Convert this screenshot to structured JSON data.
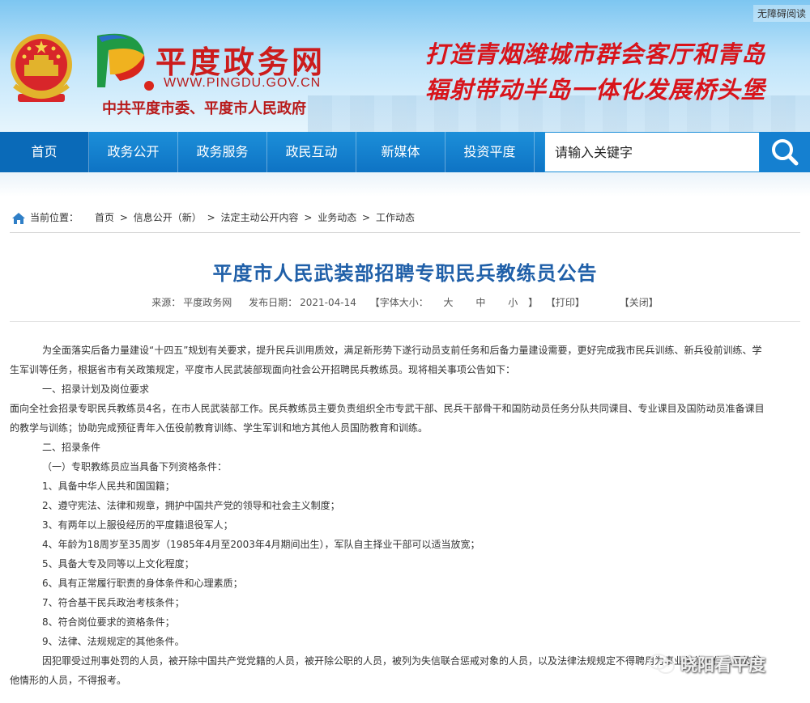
{
  "header": {
    "accessibility": "无障碍阅读",
    "site_name": "平度政务网",
    "site_url": "WWW.PINGDU.GOV.CN",
    "site_owner": "中共平度市委、平度市人民政府",
    "slogan_line1": "打造青烟潍城市群会客厅和青岛",
    "slogan_line2": "辐射带动半岛一体化发展桥头堡"
  },
  "nav": {
    "items": [
      {
        "label": "首页"
      },
      {
        "label": "政务公开"
      },
      {
        "label": "政务服务"
      },
      {
        "label": "政民互动"
      },
      {
        "label": "新媒体"
      },
      {
        "label": "投资平度"
      }
    ],
    "search_placeholder": "请输入关键字"
  },
  "breadcrumb": {
    "label": "当前位置：",
    "items": [
      "首页",
      "信息公开（新）",
      "法定主动公开内容",
      "业务动态",
      "工作动态"
    ],
    "separator": ">"
  },
  "article": {
    "title": "平度市人民武装部招聘专职民兵教练员公告",
    "source_label": "来源：",
    "source": "平度政务网",
    "date_label": "发布日期：",
    "date": "2021-04-14",
    "font_label": "【字体大小：",
    "font_large": "大",
    "font_medium": "中",
    "font_small": "小",
    "font_close": "】",
    "print": "【打印】",
    "close": "【关闭】",
    "paragraphs": [
      "为全面落实后备力量建设“十四五”规划有关要求，提升民兵训用质效，满足新形势下遂行动员支前任务和后备力量建设需要，更好完成我市民兵训练、新兵役前训练、学生军训等任务，根据省市有关政策规定，平度市人民武装部现面向社会公开招聘民兵教练员。现将相关事项公告如下：",
      "一、招录计划及岗位要求",
      "面向全社会招录专职民兵教练员4名，在市人民武装部工作。民兵教练员主要负责组织全市专武干部、民兵干部骨干和国防动员任务分队共同课目、专业课目及国防动员准备课目的教学与训练；协助完成预征青年入伍役前教育训练、学生军训和地方其他人员国防教育和训练。",
      "二、招录条件",
      "（一）专职教练员应当具备下列资格条件：",
      "1、具备中华人民共和国国籍；",
      "2、遵守宪法、法律和规章，拥护中国共产党的领导和社会主义制度；",
      "3、有两年以上服役经历的平度籍退役军人；",
      "4、年龄为18周岁至35周岁（1985年4月至2003年4月期间出生），军队自主择业干部可以适当放宽；",
      "5、具备大专及同等以上文化程度；",
      "6、具有正常履行职责的身体条件和心理素质；",
      "7、符合基干民兵政治考核条件；",
      "8、符合岗位要求的资格条件；",
      "9、法律、法规规定的其他条件。",
      "因犯罪受过刑事处罚的人员，被开除中国共产党党籍的人员，被开除公职的人员，被列为失信联合惩戒对象的人员，以及法律法规规定不得聘用为事业单位工作人员的其他情形的人员，不得报考。"
    ]
  },
  "watermark": {
    "text": "晓阳看平度"
  },
  "colors": {
    "nav_bg": "#0e73c4",
    "title_blue": "#1f5fa8",
    "brand_red": "#cc1c1c"
  }
}
